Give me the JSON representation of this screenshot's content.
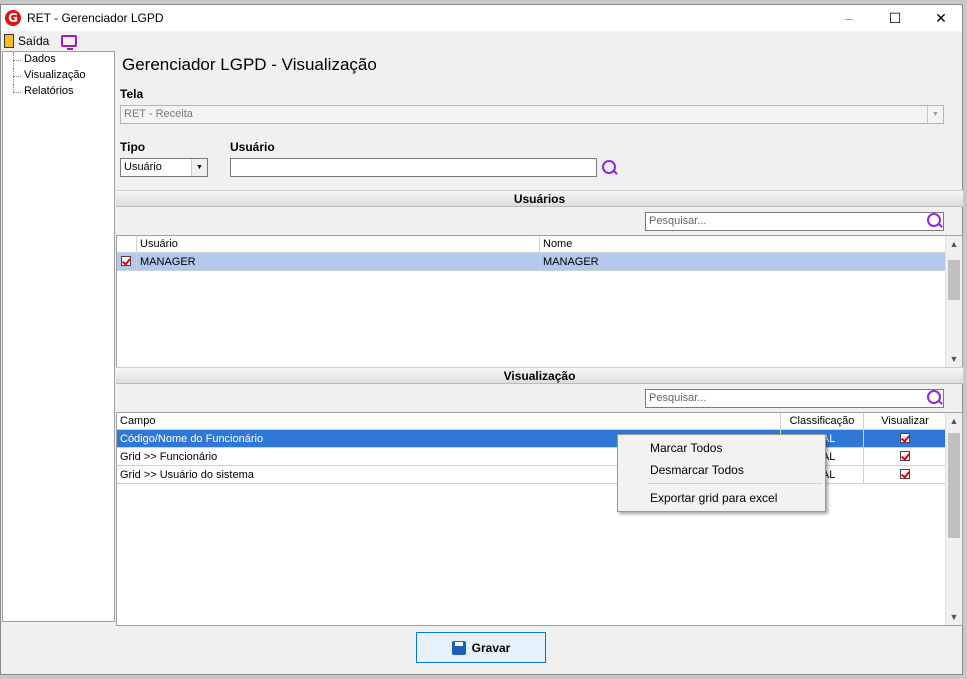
{
  "window": {
    "title": "RET - Gerenciador LGPD",
    "logo_letter": "G"
  },
  "toolbar": {
    "exit_label": "Saída"
  },
  "sidebar": {
    "items": [
      "Dados",
      "Visualização",
      "Relatórios"
    ]
  },
  "main": {
    "title": "Gerenciador LGPD - Visualização",
    "tela_label": "Tela",
    "tela_value": "RET - Receita",
    "tipo_label": "Tipo",
    "tipo_value": "Usuário",
    "usuario_label": "Usuário",
    "usuario_value": ""
  },
  "users_section": {
    "header": "Usuários",
    "search_placeholder": "Pesquisar...",
    "columns": [
      "Usuário",
      "Nome"
    ],
    "rows": [
      {
        "checked": true,
        "usuario": "MANAGER",
        "nome": "MANAGER"
      }
    ]
  },
  "view_section": {
    "header": "Visualização",
    "search_placeholder": "Pesquisar...",
    "columns": [
      "Campo",
      "Classificação",
      "Visualizar"
    ],
    "rows": [
      {
        "campo": "Código/Nome do Funcionário",
        "classificacao": "PESSOAL",
        "visualizar": true
      },
      {
        "campo": "Grid >> Funcionário",
        "classificacao": "PESSOAL",
        "visualizar": true
      },
      {
        "campo": "Grid >> Usuário do sistema",
        "classificacao": "PESSOAL",
        "visualizar": true
      }
    ]
  },
  "context_menu": {
    "items": [
      "Marcar Todos",
      "Desmarcar Todos",
      "Exportar grid para excel"
    ]
  },
  "footer": {
    "save_label": "Gravar"
  },
  "colors": {
    "accent": "#0078d7",
    "selected_row": "#2f78d8",
    "search_icon": "#8a2be2",
    "check": "#dd0000"
  }
}
